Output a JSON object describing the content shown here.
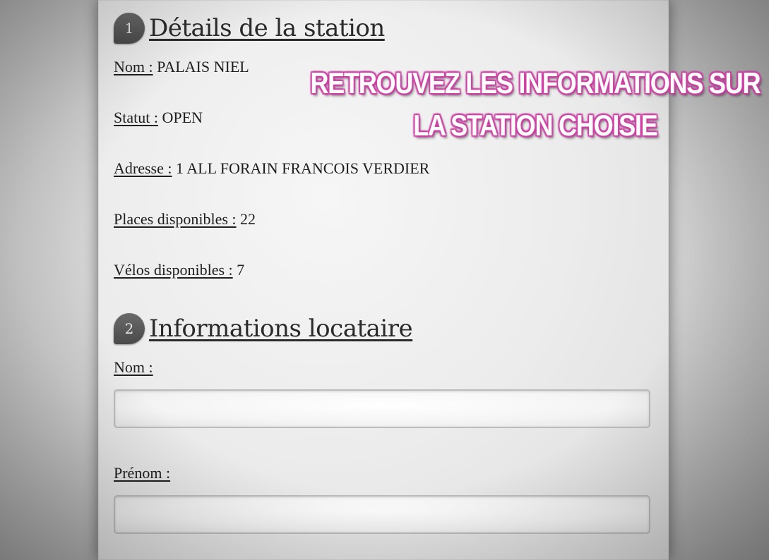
{
  "overlay": {
    "line1": "RETROUVEZ LES INFORMATIONS SUR",
    "line2": "LA STATION CHOISIE",
    "text_color": "#ffffff",
    "outline_color": "#e04bb2"
  },
  "station_section": {
    "number": "1",
    "title": "Détails de la station",
    "fields": [
      {
        "label": "Nom :",
        "value": "PALAIS NIEL"
      },
      {
        "label": "Statut :",
        "value": "OPEN"
      },
      {
        "label": "Adresse :",
        "value": "1 ALL FORAIN FRANCOIS VERDIER"
      },
      {
        "label": "Places disponibles :",
        "value": "22"
      },
      {
        "label": "Vélos disponibles :",
        "value": "7"
      }
    ]
  },
  "renter_section": {
    "number": "2",
    "title": "Informations locataire",
    "last_name_label": "Nom :",
    "last_name_value": "",
    "first_name_label": "Prénom :",
    "first_name_value": ""
  },
  "colors": {
    "badge": "#555555",
    "panel": "#ececec",
    "text": "#1e1e1e"
  }
}
